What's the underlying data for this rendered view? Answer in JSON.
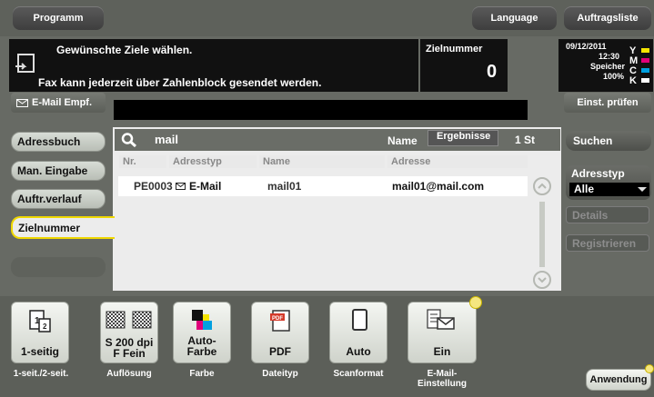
{
  "top_tabs": {
    "program": "Programm",
    "language": "Language",
    "job_list": "Auftragsliste"
  },
  "message": {
    "line1": "Gewünschte Ziele wählen.",
    "line2": "Fax kann jederzeit über Zahlenblock gesendet werden."
  },
  "dest_count": {
    "label": "Zielnummer",
    "value": "0"
  },
  "status": {
    "date": "09/12/2011",
    "time": "12:30",
    "memory_label": "Speicher",
    "memory_value": "100%",
    "toner": [
      "Y",
      "M",
      "C",
      "K"
    ]
  },
  "email_dest_label": "E-Mail Empf.",
  "check_settings": "Einst. prüfen",
  "left_menu": {
    "address_book": "Adressbuch",
    "manual_input": "Man. Eingabe",
    "job_history": "Auftr.verlauf",
    "dest_number": "Zielnummer"
  },
  "search": {
    "query": "mail",
    "field": "Name",
    "results_label": "Ergebnisse",
    "results_count": "1 St"
  },
  "table": {
    "headers": [
      "Nr.",
      "Adresstyp",
      "Name",
      "Adresse"
    ],
    "rows": [
      {
        "nr": "PE0003",
        "type": "E-Mail",
        "name": "mail01",
        "address": "mail01@mail.com"
      }
    ]
  },
  "right_panel": {
    "search": "Suchen",
    "address_type_label": "Adresstyp",
    "address_type_value": "Alle",
    "details": "Details",
    "register": "Registrieren"
  },
  "functions": [
    {
      "value": "1-seitig",
      "caption": "1-seit./2-seit."
    },
    {
      "value": "S 200 dpi\nF Fein",
      "caption": "Auflösung"
    },
    {
      "value": "Auto-Farbe",
      "caption": "Farbe"
    },
    {
      "value": "PDF",
      "caption": "Dateityp"
    },
    {
      "value": "Auto",
      "caption": "Scanformat"
    },
    {
      "value": "Ein",
      "caption": "E-Mail-\nEinstellung"
    }
  ],
  "application": "Anwendung",
  "colors": {
    "frame_gray": "#6f726c",
    "header_dark": "#111111",
    "highlight_yellow": "#f0d800",
    "result_white": "#ffffff"
  }
}
